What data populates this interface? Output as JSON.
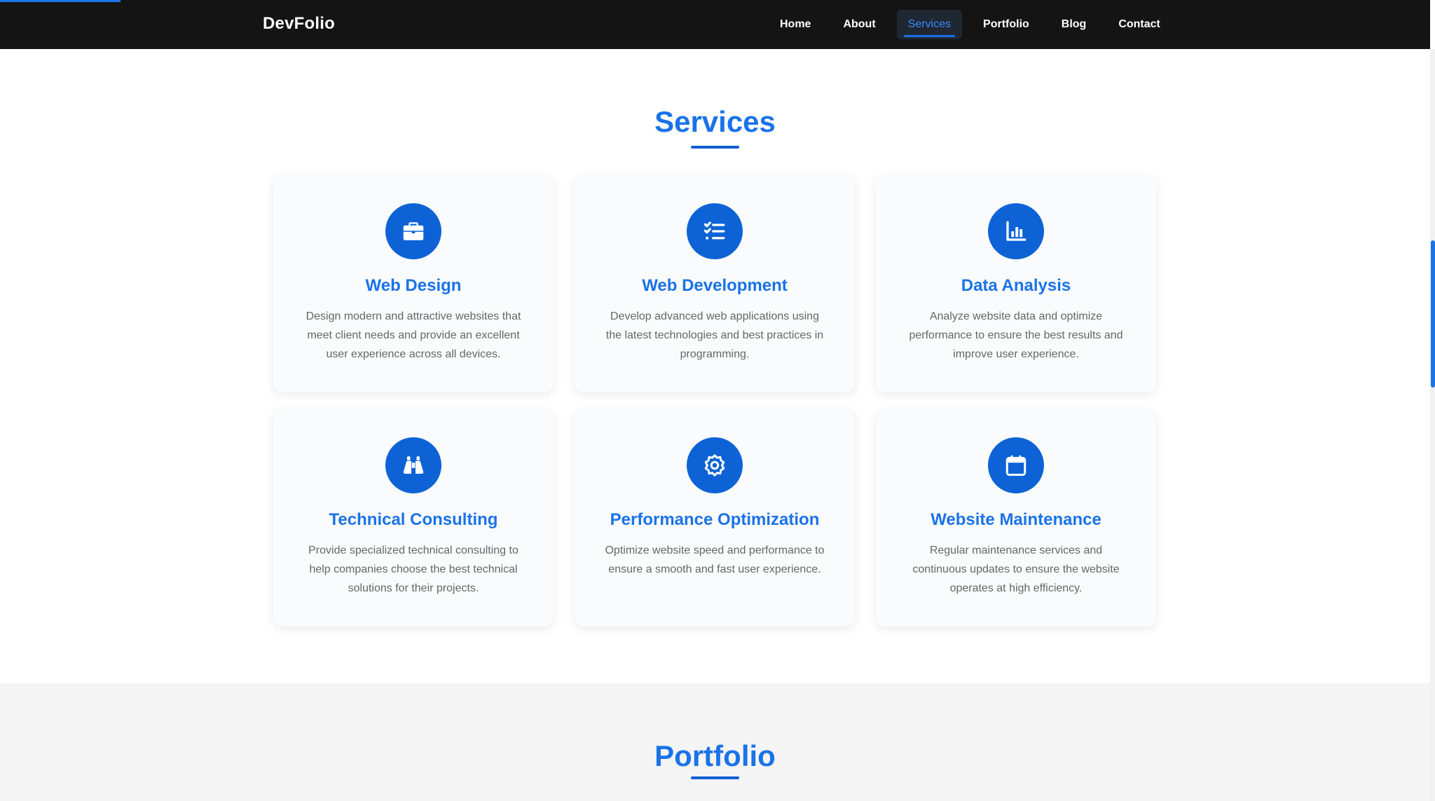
{
  "nav": {
    "brand": "DevFolio",
    "links": [
      {
        "label": "Home",
        "active": false
      },
      {
        "label": "About",
        "active": false
      },
      {
        "label": "Services",
        "active": true
      },
      {
        "label": "Portfolio",
        "active": false
      },
      {
        "label": "Blog",
        "active": false
      },
      {
        "label": "Contact",
        "active": false
      }
    ]
  },
  "services": {
    "title": "Services",
    "items": [
      {
        "icon": "briefcase-icon",
        "title": "Web Design",
        "description": "Design modern and attractive websites that meet client needs and provide an excellent user experience across all devices."
      },
      {
        "icon": "list-check-icon",
        "title": "Web Development",
        "description": "Develop advanced web applications using the latest technologies and best practices in programming."
      },
      {
        "icon": "chart-icon",
        "title": "Data Analysis",
        "description": "Analyze website data and optimize performance to ensure the best results and improve user experience."
      },
      {
        "icon": "binoculars-icon",
        "title": "Technical Consulting",
        "description": "Provide specialized technical consulting to help companies choose the best technical solutions for their projects."
      },
      {
        "icon": "gear-icon",
        "title": "Performance Optimization",
        "description": "Optimize website speed and performance to ensure a smooth and fast user experience."
      },
      {
        "icon": "calendar-icon",
        "title": "Website Maintenance",
        "description": "Regular maintenance services and continuous updates to ensure the website operates at high efficiency."
      }
    ]
  },
  "portfolio": {
    "title": "Portfolio"
  },
  "colors": {
    "accent": "#1a73e8",
    "icon_bg": "#0d63d6",
    "navbar_bg": "#141414"
  }
}
